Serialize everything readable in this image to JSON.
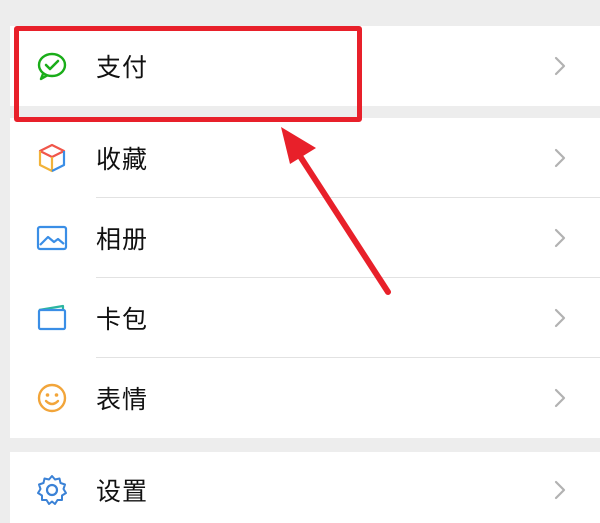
{
  "menu": {
    "items": [
      {
        "label": "支付",
        "icon": "wechat-pay-icon"
      },
      {
        "label": "收藏",
        "icon": "favorites-cube-icon"
      },
      {
        "label": "相册",
        "icon": "album-image-icon"
      },
      {
        "label": "卡包",
        "icon": "card-wallet-icon"
      },
      {
        "label": "表情",
        "icon": "sticker-smile-icon"
      },
      {
        "label": "设置",
        "icon": "settings-gear-icon"
      }
    ]
  },
  "colors": {
    "annotation": "#e8202a",
    "pay_green": "#1aad19",
    "album_blue": "#3a8ee6",
    "sticker_orange": "#f2a53a",
    "settings_blue": "#3b82d6"
  }
}
